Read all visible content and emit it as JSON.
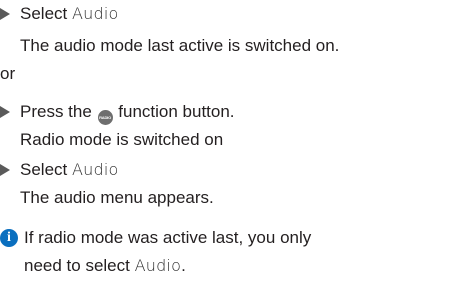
{
  "steps": [
    {
      "action_prefix": "Select ",
      "action_term": "Audio",
      "result": "The audio mode last active is switched on."
    },
    {
      "action_prefix": "Press the ",
      "action_button": "RADIO",
      "action_suffix": " function button.",
      "result": "Radio mode is switched on"
    },
    {
      "action_prefix": "Select ",
      "action_term": "Audio",
      "result": "The audio menu appears."
    }
  ],
  "separator": "or",
  "note": {
    "line1": "If radio mode was active last, you only",
    "line2_prefix": "need to select ",
    "line2_term": "Audio",
    "line2_suffix": "."
  },
  "colors": {
    "text": "#231f20",
    "arrow": "#5a5a5a",
    "info_icon": "#0a6fbf",
    "radio_button": "#6e6e6e"
  },
  "icons": {
    "step_marker": "triangle-arrow",
    "note_marker": "info-icon",
    "button_glyph": "radio-button-icon"
  }
}
